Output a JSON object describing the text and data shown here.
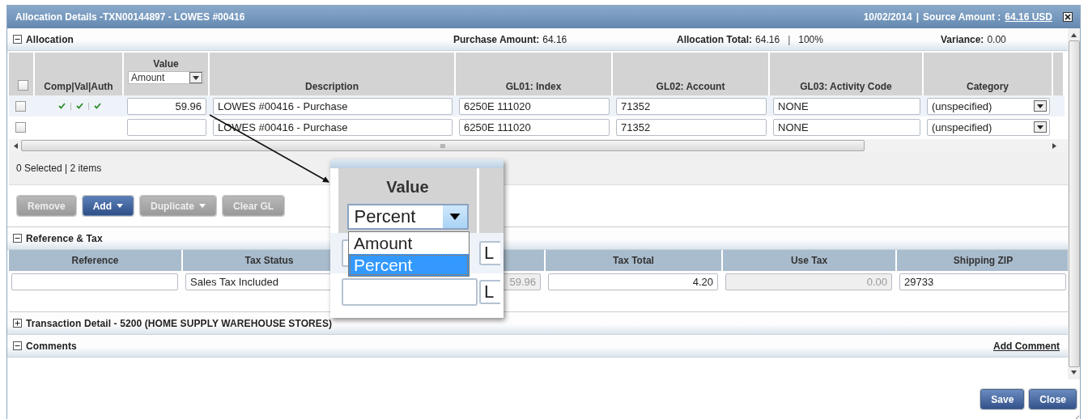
{
  "window": {
    "title": "Allocation Details -TXN00144897 - LOWES #00416",
    "date": "10/02/2014",
    "separator": "|",
    "source_amount_label": "Source Amount :",
    "source_amount": "64.16 USD"
  },
  "allocation": {
    "title": "Allocation",
    "expanded": true,
    "purchase_amount_label": "Purchase Amount:",
    "purchase_amount": "64.16",
    "allocation_total_label": "Allocation Total:",
    "allocation_total": "64.16",
    "separator": "|",
    "percent": "100%",
    "variance_label": "Variance:",
    "variance": "0.00",
    "all_checked": false,
    "columns": [
      {
        "label": "Comp|Val|Auth"
      },
      {
        "label": "Value"
      },
      {
        "label": "Description"
      },
      {
        "label": "GL01: Index"
      },
      {
        "label": "GL02: Account"
      },
      {
        "label": "GL03: Activity Code"
      },
      {
        "label": "Category"
      }
    ],
    "value_mode": "Amount",
    "rows": [
      {
        "checked": false,
        "comp": true,
        "val": true,
        "auth": true,
        "value": "59.96",
        "description": "LOWES #00416 - Purchase",
        "gl01": "6250E 111020",
        "gl02": "71352",
        "gl03": "NONE",
        "category": "(unspecified)"
      },
      {
        "checked": false,
        "comp": false,
        "val": false,
        "auth": false,
        "description": "LOWES #00416 - Purchase",
        "gl01": "6250E 111020",
        "gl02": "71352",
        "gl03": "NONE",
        "category": "(unspecified)"
      }
    ],
    "scroll_grip": "III",
    "selection_summary": "0 Selected | 2 items",
    "buttons": [
      {
        "label": "Remove",
        "disabled": true,
        "dropdown": false
      },
      {
        "label": "Add",
        "disabled": false,
        "dropdown": true
      },
      {
        "label": "Duplicate",
        "disabled": true,
        "dropdown": true
      },
      {
        "label": "Clear GL",
        "disabled": true,
        "dropdown": false
      }
    ]
  },
  "reference_tax": {
    "title": "Reference & Tax",
    "expanded": true,
    "columns": [
      {
        "label": "Reference"
      },
      {
        "label": "Tax Status"
      },
      {
        "covered": true
      },
      {
        "label": "Tax Total"
      },
      {
        "label": "Use Tax"
      },
      {
        "label": "Shipping ZIP"
      }
    ],
    "fields": [
      {
        "kind": "text",
        "disabled": false
      },
      {
        "value": "Sales Tax Included",
        "kind": "text",
        "disabled": false
      },
      {
        "value": "59.96",
        "kind": "amount",
        "disabled": true
      },
      {
        "value": "4.20",
        "kind": "amount",
        "disabled": false
      },
      {
        "value": "0.00",
        "kind": "amount",
        "disabled": true
      },
      {
        "value": "29733",
        "kind": "text",
        "disabled": false
      }
    ]
  },
  "transaction_detail": {
    "title": "Transaction Detail - 5200 (HOME SUPPLY WAREHOUSE STORES)",
    "expanded": false
  },
  "comments": {
    "title": "Comments",
    "expanded": true,
    "add_link": "Add Comment"
  },
  "footer_buttons": [
    "Save",
    "Close"
  ],
  "callout": {
    "header": "Value",
    "select_value": "Percent",
    "options": [
      {
        "label": "Amount",
        "selected": false
      },
      {
        "label": "Percent",
        "selected": true
      }
    ],
    "side_fields": [
      "L",
      "L"
    ]
  }
}
